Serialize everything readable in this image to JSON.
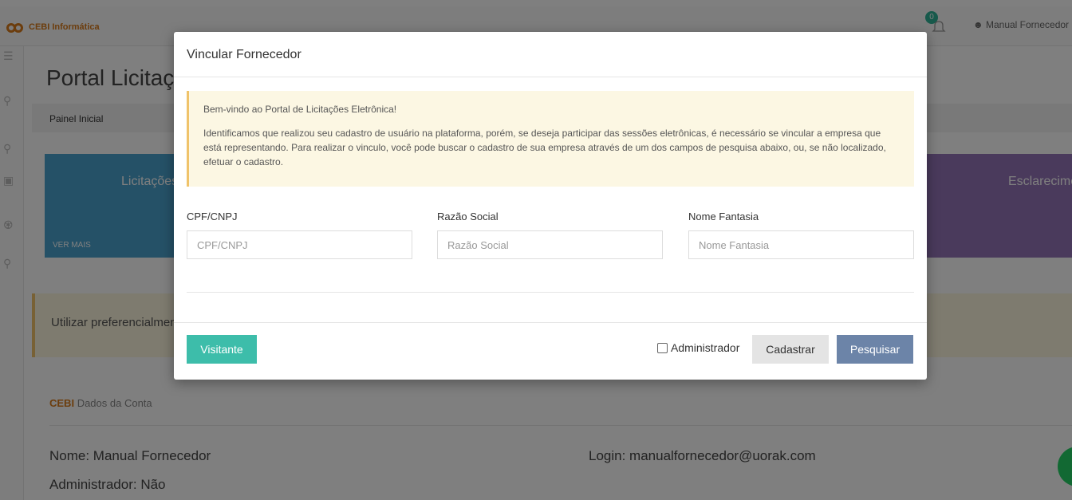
{
  "header": {
    "brand": "CEBI Informática",
    "notification_count": "0",
    "user_name": "Manual Fornecedor"
  },
  "page": {
    "title": "Portal Licitações",
    "breadcrumb": "Painel Inicial",
    "tile_left_title": "Licitações",
    "tile_left_more": "VER MAIS",
    "tile_right_title": "Esclarecimentos",
    "notice": "Utilizar preferencialmente",
    "account_brand": "CEBI",
    "account_heading": "Dados da Conta",
    "account_name": "Nome: Manual Fornecedor",
    "account_admin": "Administrador: Não",
    "account_login": "Login: manualfornecedor@uorak.com"
  },
  "modal": {
    "title": "Vincular Fornecedor",
    "alert_title": "Bem-vindo ao Portal de Licitações Eletrônica!",
    "alert_body": "Identificamos que realizou seu cadastro de usuário na plataforma, porém, se deseja participar das sessões eletrônicas, é necessário se vincular a empresa que está representando. Para realizar o vinculo, você pode buscar o cadastro de sua empresa através de um dos campos de pesquisa abaixo, ou, se não localizado, efetuar o cadastro.",
    "fields": {
      "cpf_label": "CPF/CNPJ",
      "cpf_placeholder": "CPF/CNPJ",
      "razao_label": "Razão Social",
      "razao_placeholder": "Razão Social",
      "fantasia_label": "Nome Fantasia",
      "fantasia_placeholder": "Nome Fantasia"
    },
    "visitante_label": "Visitante",
    "admin_checkbox_label": "Administrador",
    "cadastrar_label": "Cadastrar",
    "pesquisar_label": "Pesquisar"
  },
  "colors": {
    "brand": "#d87a1a",
    "teal": "#3dbdaa",
    "slate_blue": "#6c84a8"
  }
}
